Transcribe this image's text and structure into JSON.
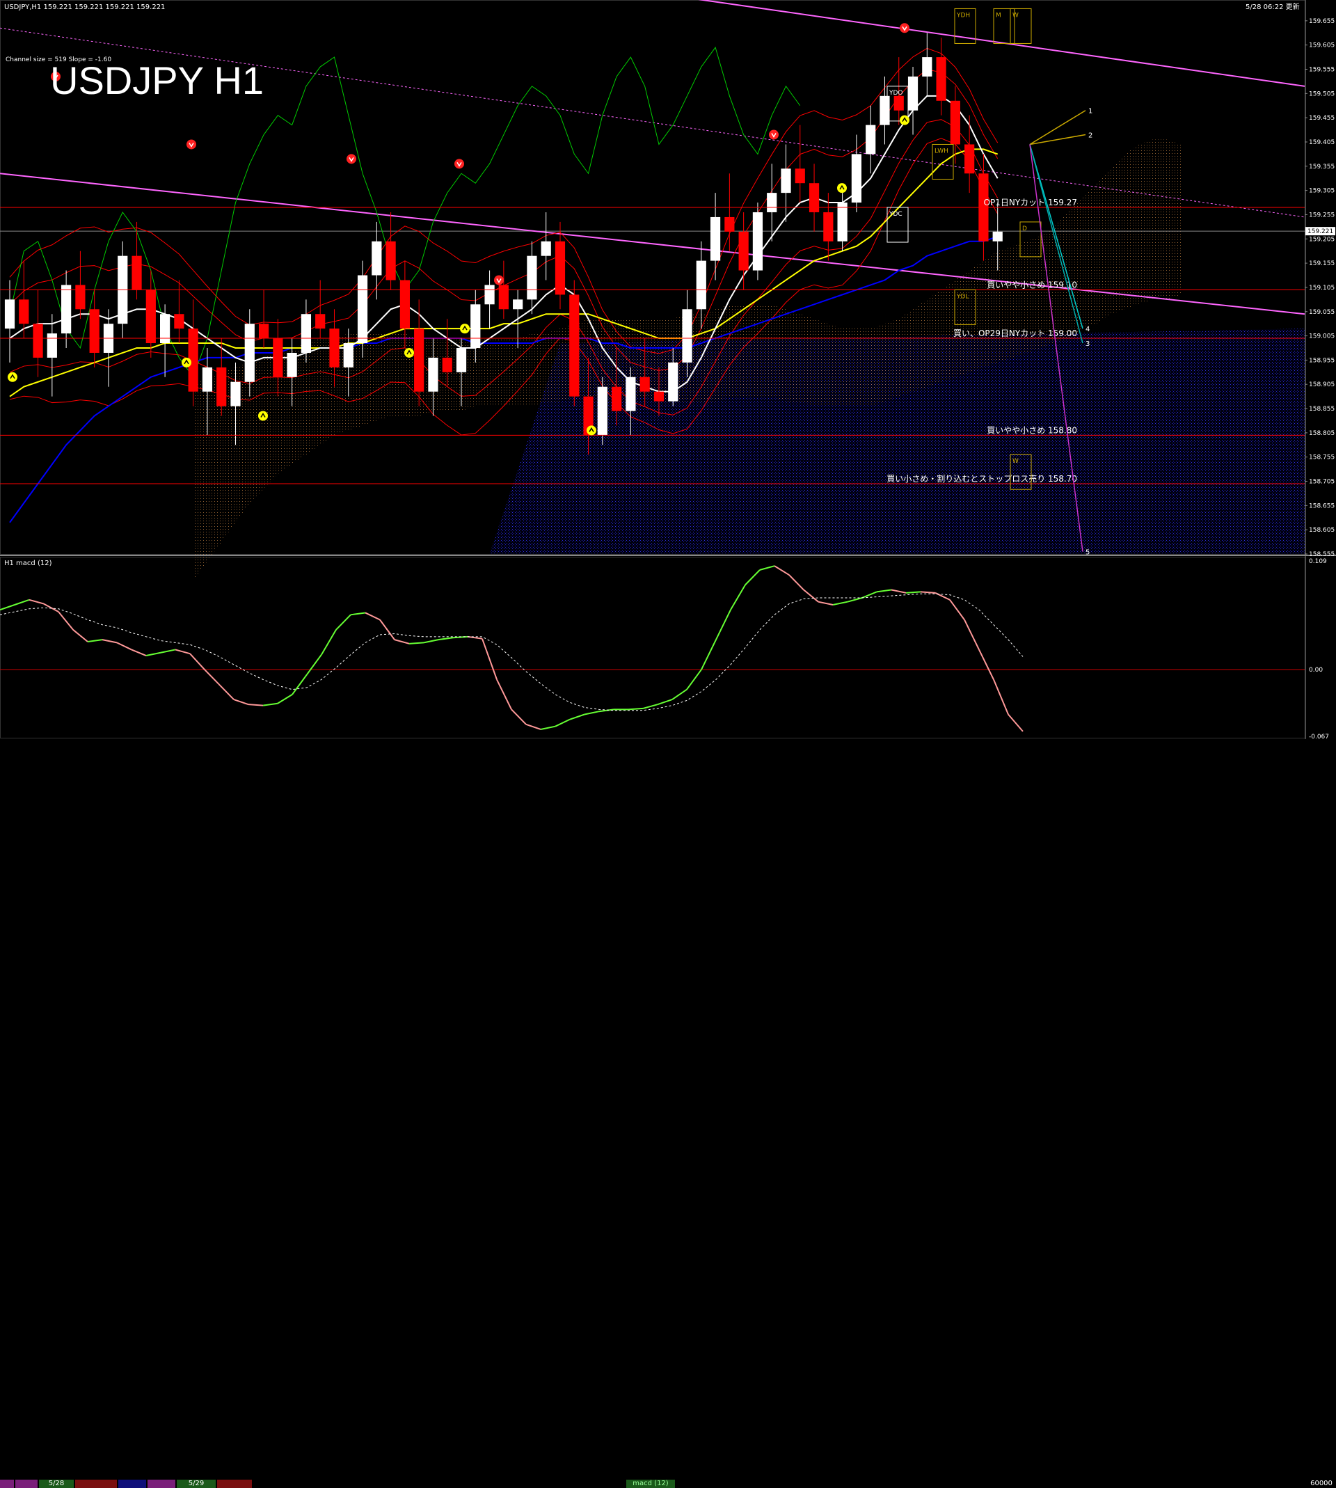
{
  "window": {
    "title": "USDJPY,H1  159.221 159.221 159.221 159.221",
    "datetime": "5/28 06:22 更新"
  },
  "overlay": {
    "symbol_title": "USDJPY H1",
    "channel_info": "Channel size = 519 Slope = -1.60"
  },
  "sub_window": {
    "title": "H1  macd (12)"
  },
  "status_bar": {
    "date_labels": [
      "5/28",
      "5/29"
    ],
    "indicator_tab": "macd (12)",
    "right_value": "60000"
  },
  "colors": {
    "background": "#000000",
    "candle_up": "#ffffff",
    "candle_down": "#ff0000",
    "ma_fast": "#ffffff",
    "ma_mid": "#ffff00",
    "ma_slow": "#0000ff",
    "chikou": "#00cc00",
    "bollinger": "#ff0000",
    "cloud_blue": "#0000cc",
    "cloud_orange": "#ff9933",
    "channel": "#ff66ff",
    "hline": "#ff0000",
    "macd_up": "#66ff33",
    "macd_down": "#ff9999"
  },
  "chart_data": [
    {
      "type": "line",
      "title": "USDJPY H1",
      "ylim": [
        158.555,
        159.695
      ],
      "y_ticks": [
        159.655,
        159.605,
        159.555,
        159.505,
        159.455,
        159.405,
        159.355,
        159.305,
        159.255,
        159.205,
        159.155,
        159.105,
        159.055,
        159.005,
        158.955,
        158.905,
        158.855,
        158.805,
        158.755,
        158.705,
        158.655,
        158.605,
        158.555
      ],
      "current_price": "159.221",
      "levels": [
        {
          "price": 159.27,
          "label": "OP1日NYカット 159.27"
        },
        {
          "price": 159.1,
          "label": "買いやや小さめ 159.10"
        },
        {
          "price": 159.0,
          "label": "買い、OP29日NYカット 159.00"
        },
        {
          "price": 158.8,
          "label": "買いやや小さめ 158.80"
        },
        {
          "price": 158.7,
          "label": "買い小さめ・割り込むとストップロス売り 158.70"
        }
      ],
      "box_labels": [
        "YDH",
        "M",
        "W",
        "YDO",
        "LWH",
        "YDC",
        "D",
        "YDL",
        "W"
      ],
      "projection_labels": [
        "1",
        "2",
        "4",
        "3",
        "5"
      ],
      "candles": [
        [
          159.02,
          159.12,
          158.95,
          159.08
        ],
        [
          159.08,
          159.16,
          159.0,
          159.03
        ],
        [
          159.03,
          159.1,
          158.92,
          158.96
        ],
        [
          158.96,
          159.05,
          158.88,
          159.01
        ],
        [
          159.01,
          159.14,
          158.98,
          159.11
        ],
        [
          159.11,
          159.18,
          159.04,
          159.06
        ],
        [
          159.06,
          159.1,
          158.94,
          158.97
        ],
        [
          158.97,
          159.06,
          158.9,
          159.03
        ],
        [
          159.03,
          159.2,
          159.0,
          159.17
        ],
        [
          159.17,
          159.24,
          159.08,
          159.1
        ],
        [
          159.1,
          159.14,
          158.96,
          158.99
        ],
        [
          158.99,
          159.07,
          158.92,
          159.05
        ],
        [
          159.05,
          159.12,
          158.99,
          159.02
        ],
        [
          159.02,
          159.08,
          158.86,
          158.89
        ],
        [
          158.89,
          158.98,
          158.8,
          158.94
        ],
        [
          158.94,
          159.0,
          158.84,
          158.86
        ],
        [
          158.86,
          158.95,
          158.78,
          158.91
        ],
        [
          158.91,
          159.06,
          158.88,
          159.03
        ],
        [
          159.03,
          159.1,
          158.98,
          159.0
        ],
        [
          159.0,
          159.04,
          158.88,
          158.92
        ],
        [
          158.92,
          159.0,
          158.86,
          158.97
        ],
        [
          158.97,
          159.08,
          158.95,
          159.05
        ],
        [
          159.05,
          159.12,
          159.0,
          159.02
        ],
        [
          159.02,
          159.06,
          158.9,
          158.94
        ],
        [
          158.94,
          159.02,
          158.88,
          158.99
        ],
        [
          158.99,
          159.16,
          158.96,
          159.13
        ],
        [
          159.13,
          159.24,
          159.08,
          159.2
        ],
        [
          159.2,
          159.26,
          159.1,
          159.12
        ],
        [
          159.12,
          159.16,
          158.98,
          159.02
        ],
        [
          159.02,
          159.08,
          158.86,
          158.89
        ],
        [
          158.89,
          159.0,
          158.84,
          158.96
        ],
        [
          158.96,
          159.04,
          158.9,
          158.93
        ],
        [
          158.93,
          159.0,
          158.86,
          158.98
        ],
        [
          158.98,
          159.1,
          158.95,
          159.07
        ],
        [
          159.07,
          159.14,
          159.02,
          159.11
        ],
        [
          159.11,
          159.16,
          159.04,
          159.06
        ],
        [
          159.06,
          159.1,
          158.98,
          159.08
        ],
        [
          159.08,
          159.2,
          159.05,
          159.17
        ],
        [
          159.17,
          159.26,
          159.12,
          159.2
        ],
        [
          159.2,
          159.24,
          159.06,
          159.09
        ],
        [
          159.09,
          159.12,
          158.86,
          158.88
        ],
        [
          158.88,
          158.96,
          158.76,
          158.8
        ],
        [
          158.8,
          158.92,
          158.78,
          158.9
        ],
        [
          158.9,
          158.98,
          158.82,
          158.85
        ],
        [
          158.85,
          158.94,
          158.8,
          158.92
        ],
        [
          158.92,
          159.0,
          158.86,
          158.89
        ],
        [
          158.89,
          158.94,
          158.84,
          158.87
        ],
        [
          158.87,
          158.98,
          158.86,
          158.95
        ],
        [
          158.95,
          159.1,
          158.92,
          159.06
        ],
        [
          159.06,
          159.2,
          159.02,
          159.16
        ],
        [
          159.16,
          159.3,
          159.12,
          159.25
        ],
        [
          159.25,
          159.34,
          159.18,
          159.22
        ],
        [
          159.22,
          159.26,
          159.1,
          159.14
        ],
        [
          159.14,
          159.28,
          159.12,
          159.26
        ],
        [
          159.26,
          159.36,
          159.2,
          159.3
        ],
        [
          159.3,
          159.4,
          159.24,
          159.35
        ],
        [
          159.35,
          159.44,
          159.28,
          159.32
        ],
        [
          159.32,
          159.36,
          159.22,
          159.26
        ],
        [
          159.26,
          159.3,
          159.16,
          159.2
        ],
        [
          159.2,
          159.3,
          159.18,
          159.28
        ],
        [
          159.28,
          159.42,
          159.26,
          159.38
        ],
        [
          159.38,
          159.48,
          159.34,
          159.44
        ],
        [
          159.44,
          159.54,
          159.4,
          159.5
        ],
        [
          159.5,
          159.58,
          159.44,
          159.47
        ],
        [
          159.47,
          159.56,
          159.42,
          159.54
        ],
        [
          159.54,
          159.63,
          159.5,
          159.58
        ],
        [
          159.58,
          159.62,
          159.46,
          159.49
        ],
        [
          159.49,
          159.52,
          159.36,
          159.4
        ],
        [
          159.4,
          159.46,
          159.3,
          159.34
        ],
        [
          159.34,
          159.38,
          159.16,
          159.2
        ],
        [
          159.2,
          159.28,
          159.14,
          159.22
        ]
      ],
      "ma_fast": [
        159.0,
        159.02,
        159.03,
        159.03,
        159.04,
        159.05,
        159.05,
        159.04,
        159.05,
        159.06,
        159.06,
        159.05,
        159.04,
        159.02,
        159.0,
        158.98,
        158.96,
        158.95,
        158.96,
        158.96,
        158.96,
        158.97,
        158.98,
        158.98,
        158.98,
        159.0,
        159.03,
        159.06,
        159.07,
        159.05,
        159.02,
        159.0,
        158.98,
        158.98,
        159.0,
        159.02,
        159.04,
        159.06,
        159.09,
        159.11,
        159.09,
        159.04,
        158.98,
        158.94,
        158.91,
        158.9,
        158.89,
        158.89,
        158.91,
        158.96,
        159.02,
        159.08,
        159.13,
        159.17,
        159.21,
        159.25,
        159.28,
        159.29,
        159.28,
        159.28,
        159.3,
        159.33,
        159.38,
        159.43,
        159.47,
        159.5,
        159.5,
        159.48,
        159.44,
        159.38,
        159.33
      ],
      "ma_mid": [
        158.88,
        158.9,
        158.91,
        158.92,
        158.93,
        158.94,
        158.95,
        158.96,
        158.97,
        158.98,
        158.98,
        158.99,
        158.99,
        158.99,
        158.99,
        158.99,
        158.98,
        158.98,
        158.98,
        158.98,
        158.98,
        158.98,
        158.98,
        158.98,
        158.99,
        158.99,
        159.0,
        159.01,
        159.02,
        159.02,
        159.02,
        159.02,
        159.02,
        159.02,
        159.02,
        159.03,
        159.03,
        159.04,
        159.05,
        159.05,
        159.05,
        159.05,
        159.04,
        159.03,
        159.02,
        159.01,
        159.0,
        159.0,
        159.0,
        159.01,
        159.02,
        159.04,
        159.06,
        159.08,
        159.1,
        159.12,
        159.14,
        159.16,
        159.17,
        159.18,
        159.19,
        159.21,
        159.24,
        159.27,
        159.3,
        159.33,
        159.36,
        159.38,
        159.39,
        159.39,
        159.38
      ],
      "ma_slow": [
        158.62,
        158.66,
        158.7,
        158.74,
        158.78,
        158.81,
        158.84,
        158.86,
        158.88,
        158.9,
        158.92,
        158.93,
        158.94,
        158.95,
        158.96,
        158.96,
        158.96,
        158.97,
        158.97,
        158.97,
        158.98,
        158.98,
        158.98,
        158.98,
        158.98,
        158.99,
        158.99,
        159.0,
        159.0,
        159.0,
        159.0,
        159.0,
        159.0,
        158.99,
        158.99,
        158.99,
        158.99,
        158.99,
        159.0,
        159.0,
        159.0,
        159.0,
        158.99,
        158.99,
        158.98,
        158.98,
        158.98,
        158.98,
        158.98,
        158.99,
        159.0,
        159.01,
        159.02,
        159.03,
        159.04,
        159.05,
        159.06,
        159.07,
        159.08,
        159.09,
        159.1,
        159.11,
        159.12,
        159.14,
        159.15,
        159.17,
        159.18,
        159.19,
        159.2,
        159.2,
        159.21
      ],
      "chikou": [
        159.05,
        159.18,
        159.2,
        159.12,
        159.02,
        158.98,
        159.1,
        159.2,
        159.26,
        159.22,
        159.14,
        159.02,
        158.96,
        158.92,
        159.0,
        159.14,
        159.28,
        159.36,
        159.42,
        159.46,
        159.44,
        159.52,
        159.56,
        159.58,
        159.46,
        159.34,
        159.26,
        159.16,
        159.1,
        159.14,
        159.24,
        159.3,
        159.34,
        159.32,
        159.36,
        159.42,
        159.48,
        159.52,
        159.5,
        159.46,
        159.38,
        159.34,
        159.46,
        159.54,
        159.58,
        159.52,
        159.4,
        159.44,
        159.5,
        159.56,
        159.6,
        159.5,
        159.42,
        159.38,
        159.46,
        159.52,
        159.48
      ]
    },
    {
      "type": "line",
      "title": "H1 macd (12)",
      "ylim": [
        -0.067,
        0.109
      ],
      "y_ticks": [
        0.109,
        0.0,
        -0.067
      ],
      "series": [
        {
          "name": "macd",
          "values": [
            0.06,
            0.065,
            0.07,
            0.066,
            0.058,
            0.04,
            0.028,
            0.03,
            0.027,
            0.02,
            0.014,
            0.017,
            0.02,
            0.016,
            0.0,
            -0.015,
            -0.03,
            -0.035,
            -0.036,
            -0.034,
            -0.025,
            -0.005,
            0.015,
            0.04,
            0.055,
            0.057,
            0.05,
            0.03,
            0.026,
            0.027,
            0.03,
            0.032,
            0.033,
            0.031,
            -0.01,
            -0.04,
            -0.055,
            -0.06,
            -0.057,
            -0.05,
            -0.045,
            -0.042,
            -0.04,
            -0.04,
            -0.039,
            -0.035,
            -0.03,
            -0.02,
            0.0,
            0.03,
            0.06,
            0.085,
            0.1,
            0.104,
            0.095,
            0.08,
            0.068,
            0.065,
            0.068,
            0.072,
            0.078,
            0.08,
            0.077,
            0.078,
            0.077,
            0.07,
            0.05,
            0.02,
            -0.01,
            -0.045,
            -0.062
          ]
        },
        {
          "name": "signal",
          "values": [
            0.055,
            0.058,
            0.061,
            0.062,
            0.061,
            0.056,
            0.05,
            0.045,
            0.042,
            0.037,
            0.033,
            0.029,
            0.027,
            0.025,
            0.02,
            0.013,
            0.005,
            -0.003,
            -0.01,
            -0.016,
            -0.02,
            -0.018,
            -0.01,
            0.002,
            0.015,
            0.027,
            0.035,
            0.036,
            0.034,
            0.033,
            0.033,
            0.033,
            0.033,
            0.033,
            0.025,
            0.012,
            -0.002,
            -0.014,
            -0.025,
            -0.033,
            -0.038,
            -0.04,
            -0.041,
            -0.041,
            -0.041,
            -0.039,
            -0.036,
            -0.031,
            -0.022,
            -0.01,
            0.005,
            0.022,
            0.04,
            0.055,
            0.066,
            0.071,
            0.072,
            0.072,
            0.072,
            0.072,
            0.073,
            0.074,
            0.075,
            0.076,
            0.076,
            0.075,
            0.07,
            0.06,
            0.045,
            0.03,
            0.013
          ]
        }
      ]
    }
  ]
}
